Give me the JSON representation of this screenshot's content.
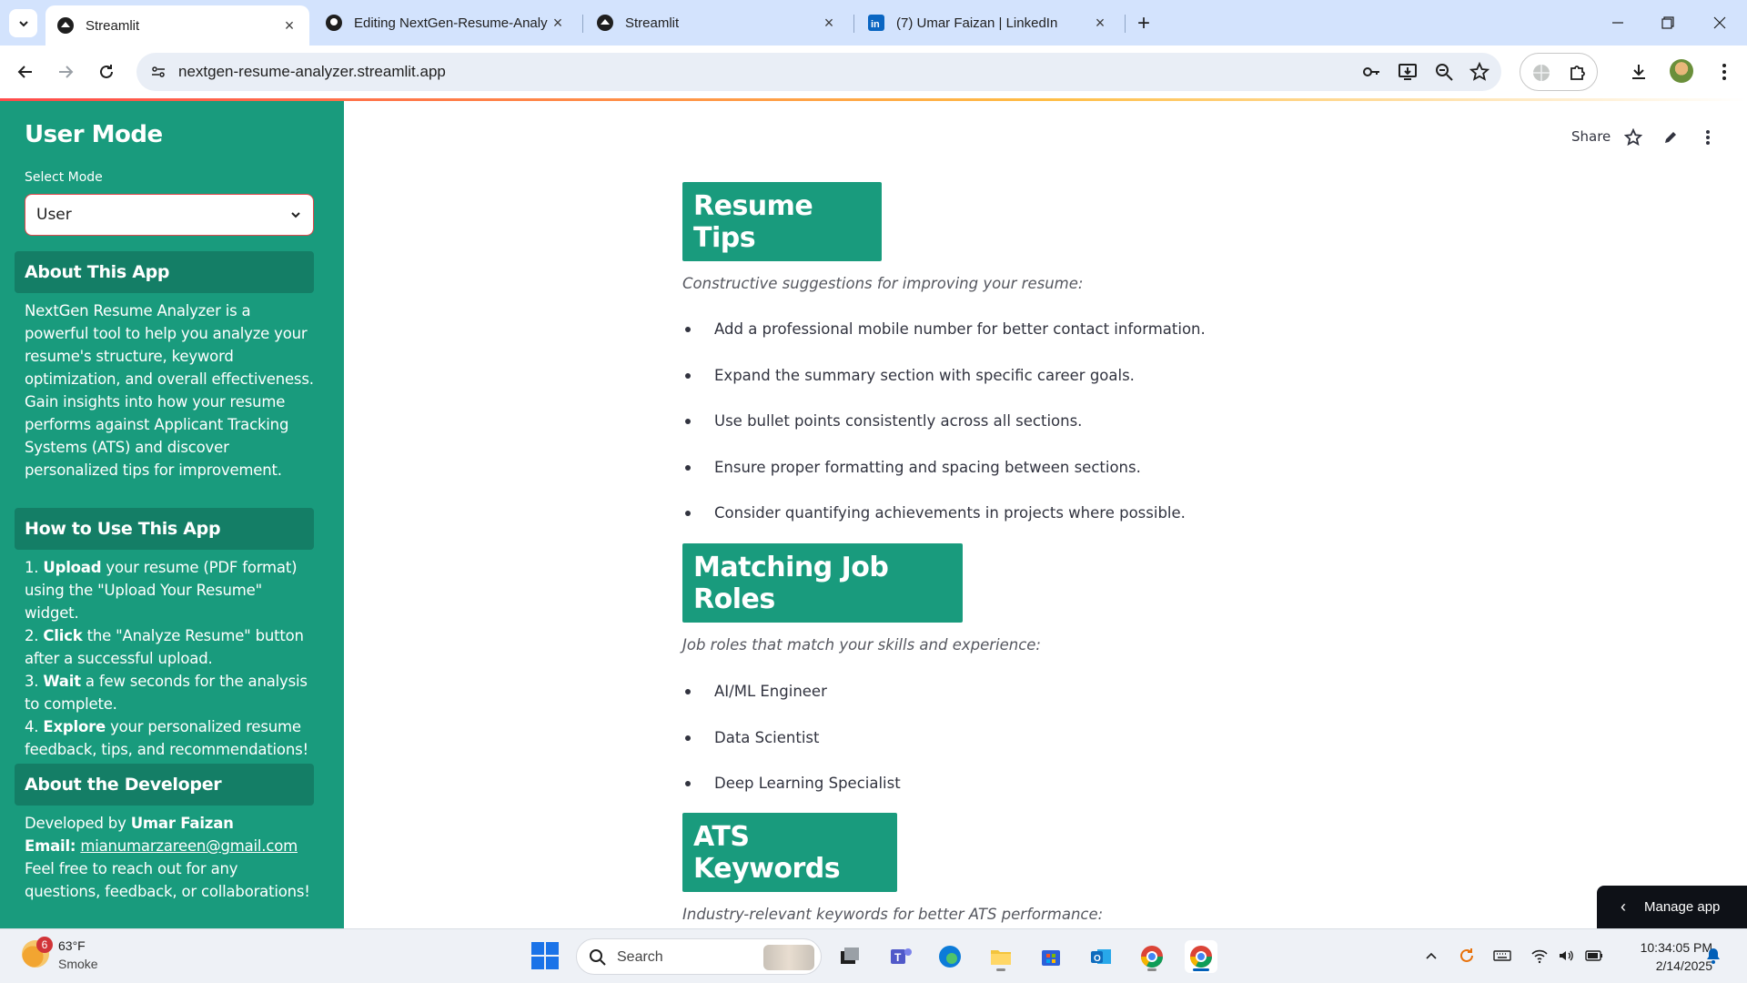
{
  "browser": {
    "tabs": [
      {
        "title": "Streamlit",
        "active": true,
        "favicon": "streamlit-icon"
      },
      {
        "title": "Editing NextGen-Resume-Analy",
        "active": false,
        "favicon": "github-icon"
      },
      {
        "title": "Streamlit",
        "active": false,
        "favicon": "streamlit-icon"
      },
      {
        "title": "(7) Umar Faizan | LinkedIn",
        "active": false,
        "favicon": "linkedin-icon"
      }
    ],
    "url": "nextgen-resume-analyzer.streamlit.app"
  },
  "sidebar": {
    "title": "User Mode",
    "select_label": "Select Mode",
    "select_value": "User",
    "about": {
      "heading": "About This App",
      "text": "NextGen Resume Analyzer is a powerful tool to help you analyze your resume's structure, keyword optimization, and overall effectiveness. Gain insights into how your resume performs against Applicant Tracking Systems (ATS) and discover personalized tips for improvement."
    },
    "howto": {
      "heading": "How to Use This App",
      "steps": [
        {
          "num": "1.",
          "bold": "Upload",
          "rest": " your resume (PDF format) using the \"Upload Your Resume\" widget."
        },
        {
          "num": "2.",
          "bold": "Click",
          "rest": " the \"Analyze Resume\" button after a successful upload."
        },
        {
          "num": "3.",
          "bold": "Wait",
          "rest": " a few seconds for the analysis to complete."
        },
        {
          "num": "4.",
          "bold": "Explore",
          "rest": " your personalized resume feedback, tips, and recommendations!"
        }
      ]
    },
    "developer": {
      "heading": "About the Developer",
      "developed_by_prefix": "Developed by ",
      "developer_name": "Umar Faizan",
      "email_label": "Email:",
      "email": "mianumarzareen@gmail.com",
      "closing": "Feel free to reach out for any questions, feedback, or collaborations!"
    }
  },
  "main": {
    "share_label": "Share",
    "sections": [
      {
        "heading": "Resume Tips",
        "caption": "Constructive suggestions for improving your resume:",
        "items": [
          "Add a professional mobile number for better contact information.",
          "Expand the summary section with specific career goals.",
          "Use bullet points consistently across all sections.",
          "Ensure proper formatting and spacing between sections.",
          "Consider quantifying achievements in projects where possible."
        ]
      },
      {
        "heading": "Matching Job Roles",
        "caption": "Job roles that match your skills and experience:",
        "items": [
          "AI/ML Engineer",
          "Data Scientist",
          "Deep Learning Specialist"
        ]
      },
      {
        "heading": "ATS Keywords",
        "caption": "Industry-relevant keywords for better ATS performance:",
        "items": []
      }
    ],
    "manage_app_label": "Manage app"
  },
  "taskbar": {
    "weather_temp": "63°F",
    "weather_desc": "Smoke",
    "weather_badge": "6",
    "search_label": "Search",
    "time": "10:34:05 PM",
    "date": "2/14/2025"
  },
  "colors": {
    "sidebar_bg": "#199b7d",
    "sidebar_heading_bg": "#147e66",
    "section_heading_bg": "#199b7d",
    "accent_red": "#ff4b4b"
  }
}
